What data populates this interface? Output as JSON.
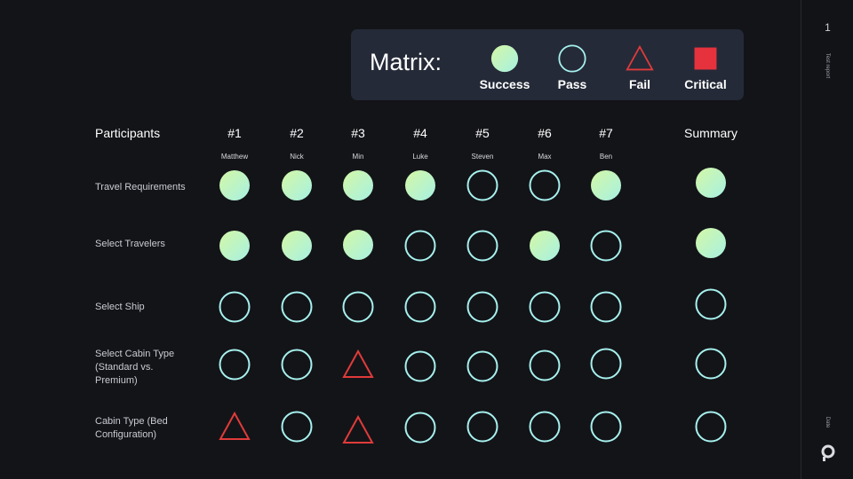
{
  "sidebar": {
    "page_number": "1",
    "report_label": "Test report",
    "date_label": "Date"
  },
  "legend": {
    "title": "Matrix:",
    "items": [
      {
        "status": "success",
        "label": "Success"
      },
      {
        "status": "pass",
        "label": "Pass"
      },
      {
        "status": "fail",
        "label": "Fail"
      },
      {
        "status": "critical",
        "label": "Critical"
      }
    ]
  },
  "headers": {
    "participants": "Participants",
    "summary": "Summary"
  },
  "participants": [
    {
      "id": "#1",
      "name": "Matthew"
    },
    {
      "id": "#2",
      "name": "Nick"
    },
    {
      "id": "#3",
      "name": "Min"
    },
    {
      "id": "#4",
      "name": "Luke"
    },
    {
      "id": "#5",
      "name": "Steven"
    },
    {
      "id": "#6",
      "name": "Max"
    },
    {
      "id": "#7",
      "name": "Ben"
    }
  ],
  "rows": [
    {
      "label": "Travel Requirements",
      "results": [
        "success",
        "success",
        "success",
        "success",
        "pass",
        "pass",
        "success"
      ],
      "summary": "success"
    },
    {
      "label": "Select Travelers",
      "results": [
        "success",
        "success",
        "success",
        "pass",
        "pass",
        "success",
        "pass"
      ],
      "summary": "success"
    },
    {
      "label": "Select Ship",
      "results": [
        "pass",
        "pass",
        "pass",
        "pass",
        "pass",
        "pass",
        "pass"
      ],
      "summary": "pass"
    },
    {
      "label": "Select Cabin Type (Standard vs. Premium)",
      "results": [
        "pass",
        "pass",
        "fail",
        "pass",
        "pass",
        "pass",
        "pass"
      ],
      "summary": "pass"
    },
    {
      "label": "Cabin Type (Bed Configuration)",
      "results": [
        "fail",
        "pass",
        "fail",
        "pass",
        "pass",
        "pass",
        "pass"
      ],
      "summary": "pass"
    }
  ],
  "colors": {
    "success_gradient": [
      "#d4f7a6",
      "#a7f1e2"
    ],
    "pass_stroke": "#a6f1ee",
    "fail_stroke": "#e03b3b",
    "critical_fill": "#e5323d",
    "background": "#131418",
    "legend_bg": "#252a38"
  }
}
